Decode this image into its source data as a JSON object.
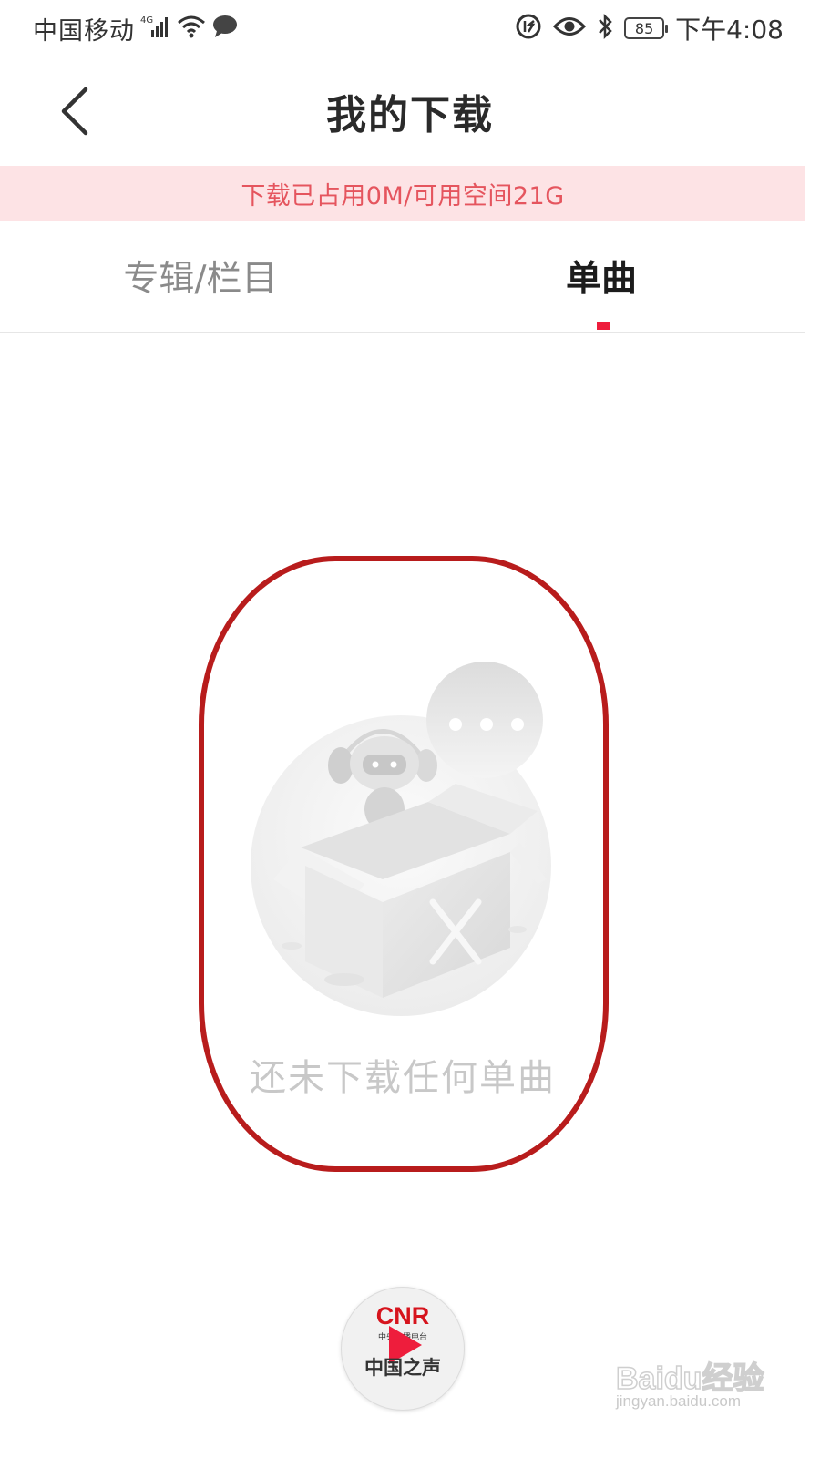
{
  "status_bar": {
    "carrier": "中国移动",
    "network": "4G",
    "battery": "85",
    "time": "下午4:08"
  },
  "nav": {
    "title": "我的下载"
  },
  "storage_banner": {
    "text": "下载已占用0M/可用空间21G"
  },
  "tabs": [
    {
      "label": "专辑/栏目",
      "active": false
    },
    {
      "label": "单曲",
      "active": true
    }
  ],
  "empty_state": {
    "message": "还未下载任何单曲"
  },
  "player": {
    "brand": "CNR",
    "subtitle": "中央广播电台",
    "name": "中国之声"
  },
  "watermark": {
    "brand": "Baidu经验",
    "url": "jingyan.baidu.com"
  },
  "colors": {
    "accent": "#ee1d3c",
    "banner_bg": "#fde3e5",
    "banner_text": "#e5555e",
    "annotation_ring": "#b81c1c"
  }
}
